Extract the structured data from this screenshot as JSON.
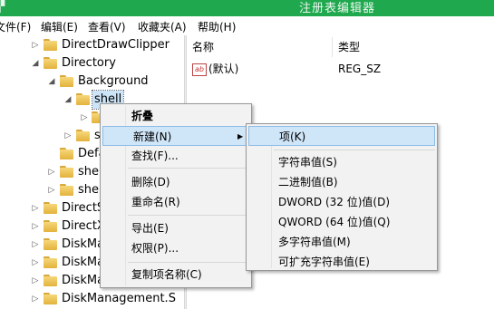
{
  "window": {
    "title": "注册表编辑器",
    "window_icon": "registry-icon"
  },
  "menubar": {
    "file": "文件(F)",
    "edit": "编辑(E)",
    "view": "查看(V)",
    "favorites": "收藏夹(A)",
    "help": "帮助(H)"
  },
  "tree": {
    "items": [
      {
        "label": "DirectDrawClipper",
        "twisty": "▷"
      },
      {
        "label": "Directory",
        "twisty": "◢"
      },
      {
        "label": "Background",
        "twisty": "◢"
      },
      {
        "label": "shell",
        "twisty": "◢"
      },
      {
        "label": "",
        "twisty": "▷"
      },
      {
        "label": "s",
        "twisty": "▷"
      },
      {
        "label": "Defa",
        "twisty": ""
      },
      {
        "label": "shel",
        "twisty": "▷"
      },
      {
        "label": "shel",
        "twisty": "▷"
      },
      {
        "label": "DirectS",
        "twisty": "▷"
      },
      {
        "label": "DirectX",
        "twisty": "▷"
      },
      {
        "label": "DiskMa",
        "twisty": "▷"
      },
      {
        "label": "DiskMa",
        "twisty": "▷"
      },
      {
        "label": "DiskMa",
        "twisty": "▷"
      },
      {
        "label": "DiskManagement.S",
        "twisty": "▷"
      }
    ]
  },
  "list": {
    "col_name": "名称",
    "col_type": "类型",
    "rows": [
      {
        "name": "(默认)",
        "type": "REG_SZ",
        "icon": "ab-string-icon"
      }
    ]
  },
  "context_menu": {
    "items": [
      "折叠",
      "新建(N)",
      "查找(F)...",
      "删除(D)",
      "重命名(R)",
      "导出(E)",
      "权限(P)...",
      "复制项名称(C)"
    ],
    "highlighted": "新建(N)"
  },
  "submenu": {
    "items": [
      "项(K)",
      "字符串值(S)",
      "二进制值(B)",
      "DWORD (32 位)值(D)",
      "QWORD (64 位)值(Q)",
      "多字符串值(M)",
      "可扩充字符串值(E)"
    ],
    "highlighted": "项(K)"
  },
  "colors": {
    "titlebar": "#1fa84e",
    "highlight": "#cfe5f8",
    "selection": "#cce4f7",
    "folder": "#f6d77a"
  }
}
